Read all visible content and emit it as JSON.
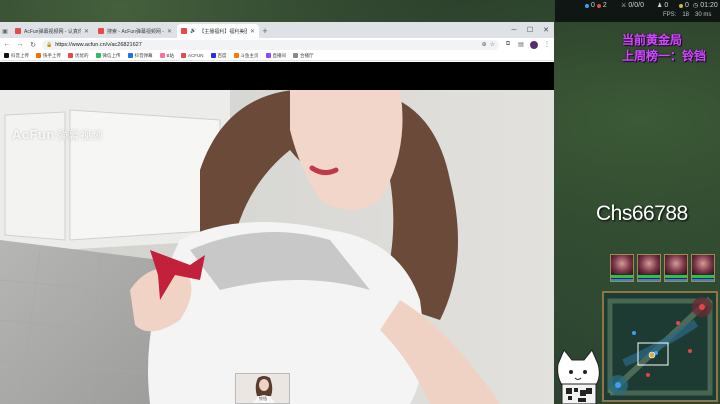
{
  "game": {
    "topbar": {
      "score_left": "0",
      "score_right": "2",
      "kda": "0/0/0",
      "cs": "0",
      "gold": "0",
      "time": "01:20",
      "fps_label": "FPS:",
      "fps_value": "18",
      "ping": "30 ms"
    },
    "overlay_line1": "当前黄金局",
    "overlay_line2": "上周榜一：铃铛",
    "streamer_id": "Chs66788"
  },
  "browser": {
    "tabs": [
      {
        "label": "AcFun弹幕视频网 - 认真你就输啦 (",
        "active": false
      },
      {
        "label": "搜索 - AcFun弹幕视频网 - 认真你",
        "active": false
      },
      {
        "label": "【主播福利】福利美图日常",
        "active": true
      }
    ],
    "address": {
      "url": "https://www.acfun.cn/v/ac26821627"
    },
    "bookmarks": [
      {
        "label": "抖音上传",
        "color": "#111111"
      },
      {
        "label": "快手上传",
        "color": "#ff6a00"
      },
      {
        "label": "优优的",
        "color": "#e54b4b"
      },
      {
        "label": "微信上传",
        "color": "#2dbe60"
      },
      {
        "label": "抖音弹幕",
        "color": "#1a73e8"
      },
      {
        "label": "B站",
        "color": "#fb7299"
      },
      {
        "label": "ACFUN",
        "color": "#e54b4b"
      },
      {
        "label": "百度",
        "color": "#2932e1"
      },
      {
        "label": "斗鱼主页",
        "color": "#ff7700"
      },
      {
        "label": "直播间",
        "color": "#9146ff"
      },
      {
        "label": "合播厅",
        "color": "#888888"
      }
    ],
    "watermark": {
      "brand": "AcFun",
      "suffix": "弹幕视频"
    },
    "webcam_label": "铃铛"
  },
  "colors": {
    "overlay_text": "#d04bff",
    "acfun_red": "#e54b4b"
  }
}
